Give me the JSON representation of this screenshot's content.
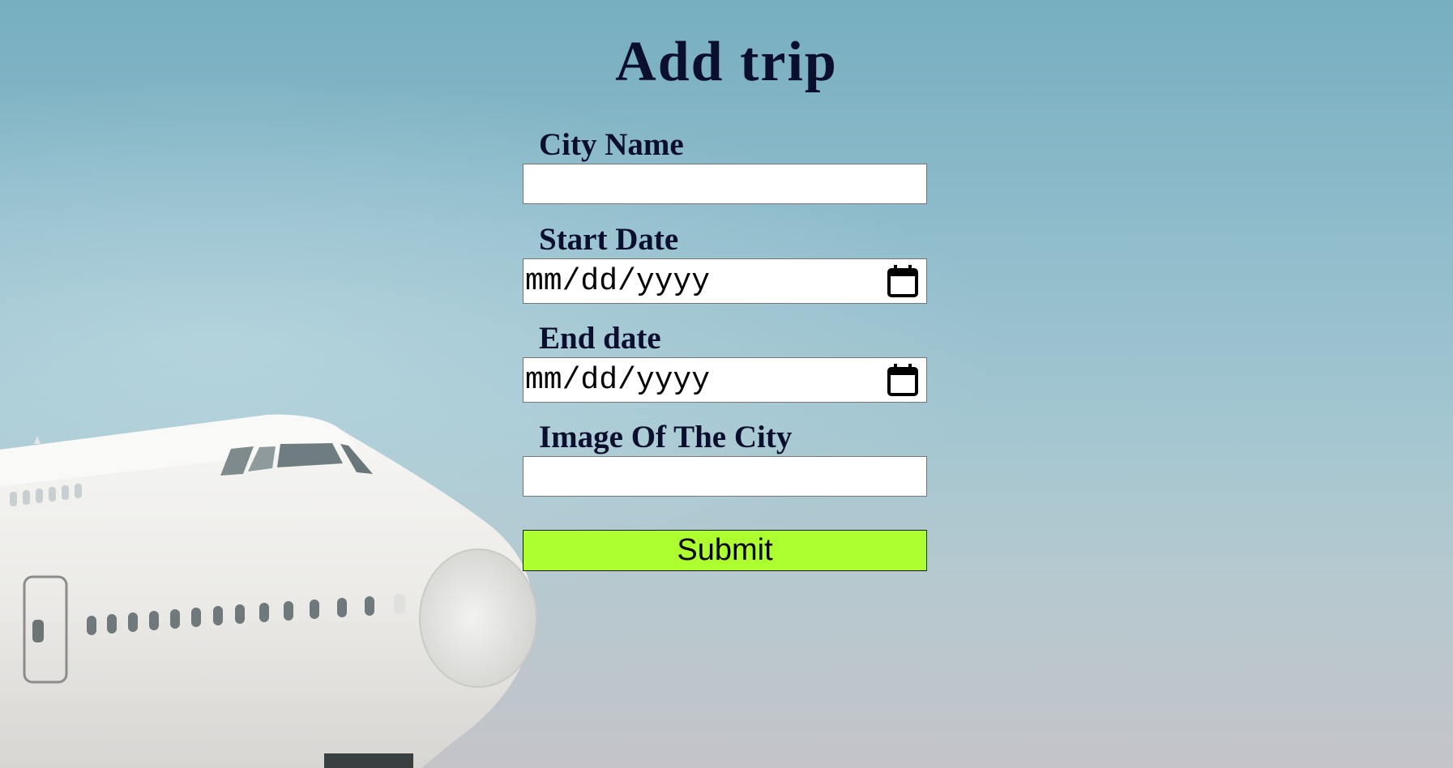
{
  "page": {
    "title": "Add trip"
  },
  "form": {
    "city_name": {
      "label": "City Name",
      "value": "",
      "placeholder": ""
    },
    "start_date": {
      "label": "Start Date",
      "placeholder": "mm/dd/yyyy",
      "icon": "calendar-icon"
    },
    "end_date": {
      "label": "End date",
      "placeholder": "mm/dd/yyyy",
      "icon": "calendar-icon"
    },
    "city_image": {
      "label": "Image Of The City",
      "value": "",
      "placeholder": ""
    },
    "submit_label": "Submit"
  },
  "colors": {
    "heading_text": "#0b0f2e",
    "submit_background": "#adff2f",
    "input_background": "#ffffff"
  }
}
